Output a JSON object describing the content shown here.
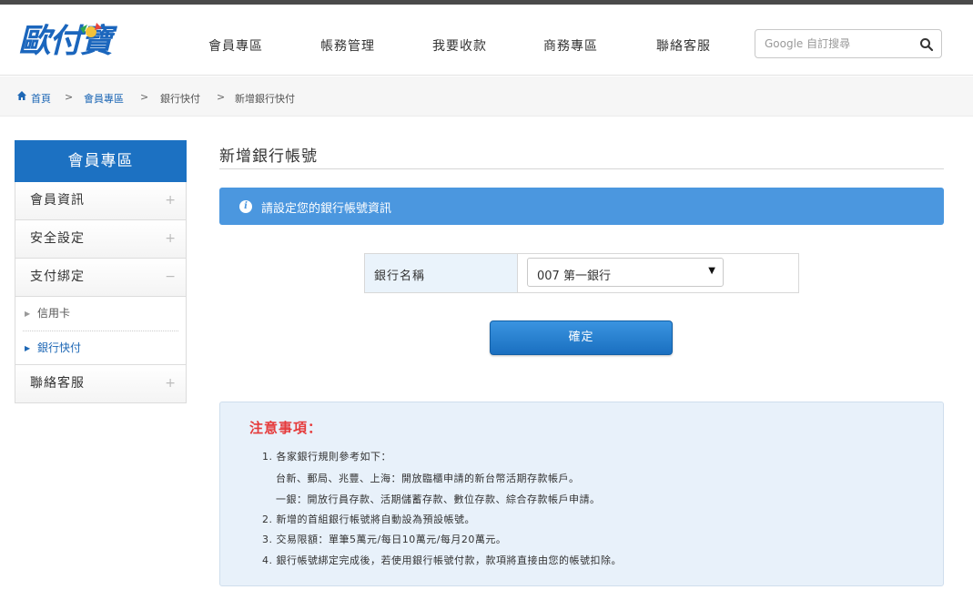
{
  "logo": {
    "text": "歐付寶"
  },
  "nav": {
    "items": [
      "會員專區",
      "帳務管理",
      "我要收款",
      "商務專區",
      "聯絡客服"
    ]
  },
  "search": {
    "placeholder": "Google 自訂搜尋"
  },
  "breadcrumb": {
    "home": "首頁",
    "member": "會員專區",
    "bank": "銀行快付",
    "current": "新增銀行快付",
    "sep": ">"
  },
  "sidebar": {
    "heading": "會員專區",
    "items": [
      {
        "label": "會員資訊",
        "sign": "+"
      },
      {
        "label": "安全設定",
        "sign": "+"
      },
      {
        "label": "支付綁定",
        "sign": "−"
      },
      {
        "label": "聯絡客服",
        "sign": "+"
      }
    ],
    "sub_items": [
      {
        "label": "信用卡"
      },
      {
        "label": "銀行快付"
      }
    ]
  },
  "main": {
    "title": "新增銀行帳號",
    "info": "請設定您的銀行帳號資訊",
    "bank_label": "銀行名稱",
    "bank_selected": "007 第一銀行",
    "confirm": "確定"
  },
  "notice": {
    "title": "注意事項：",
    "lines": [
      "1. 各家銀行規則參考如下：",
      "台新、郵局、兆豐、上海：開放臨櫃申請的新台幣活期存款帳戶。",
      "一銀：開放行員存款、活期儲蓄存款、數位存款、綜合存款帳戶申請。",
      "2. 新增的首組銀行帳號將自動設為預設帳號。",
      "3. 交易限額：單筆5萬元/每日10萬元/每月20萬元。",
      "4. 銀行帳號綁定完成後，若使用銀行帳號付款，款項將直接由您的帳號扣除。"
    ]
  },
  "colors": {
    "primary": "#1c71c2",
    "info_bar": "#4b97df",
    "notice_bg": "#e8f1fa",
    "notice_title": "#e53b3b",
    "link": "#1d67b5"
  }
}
